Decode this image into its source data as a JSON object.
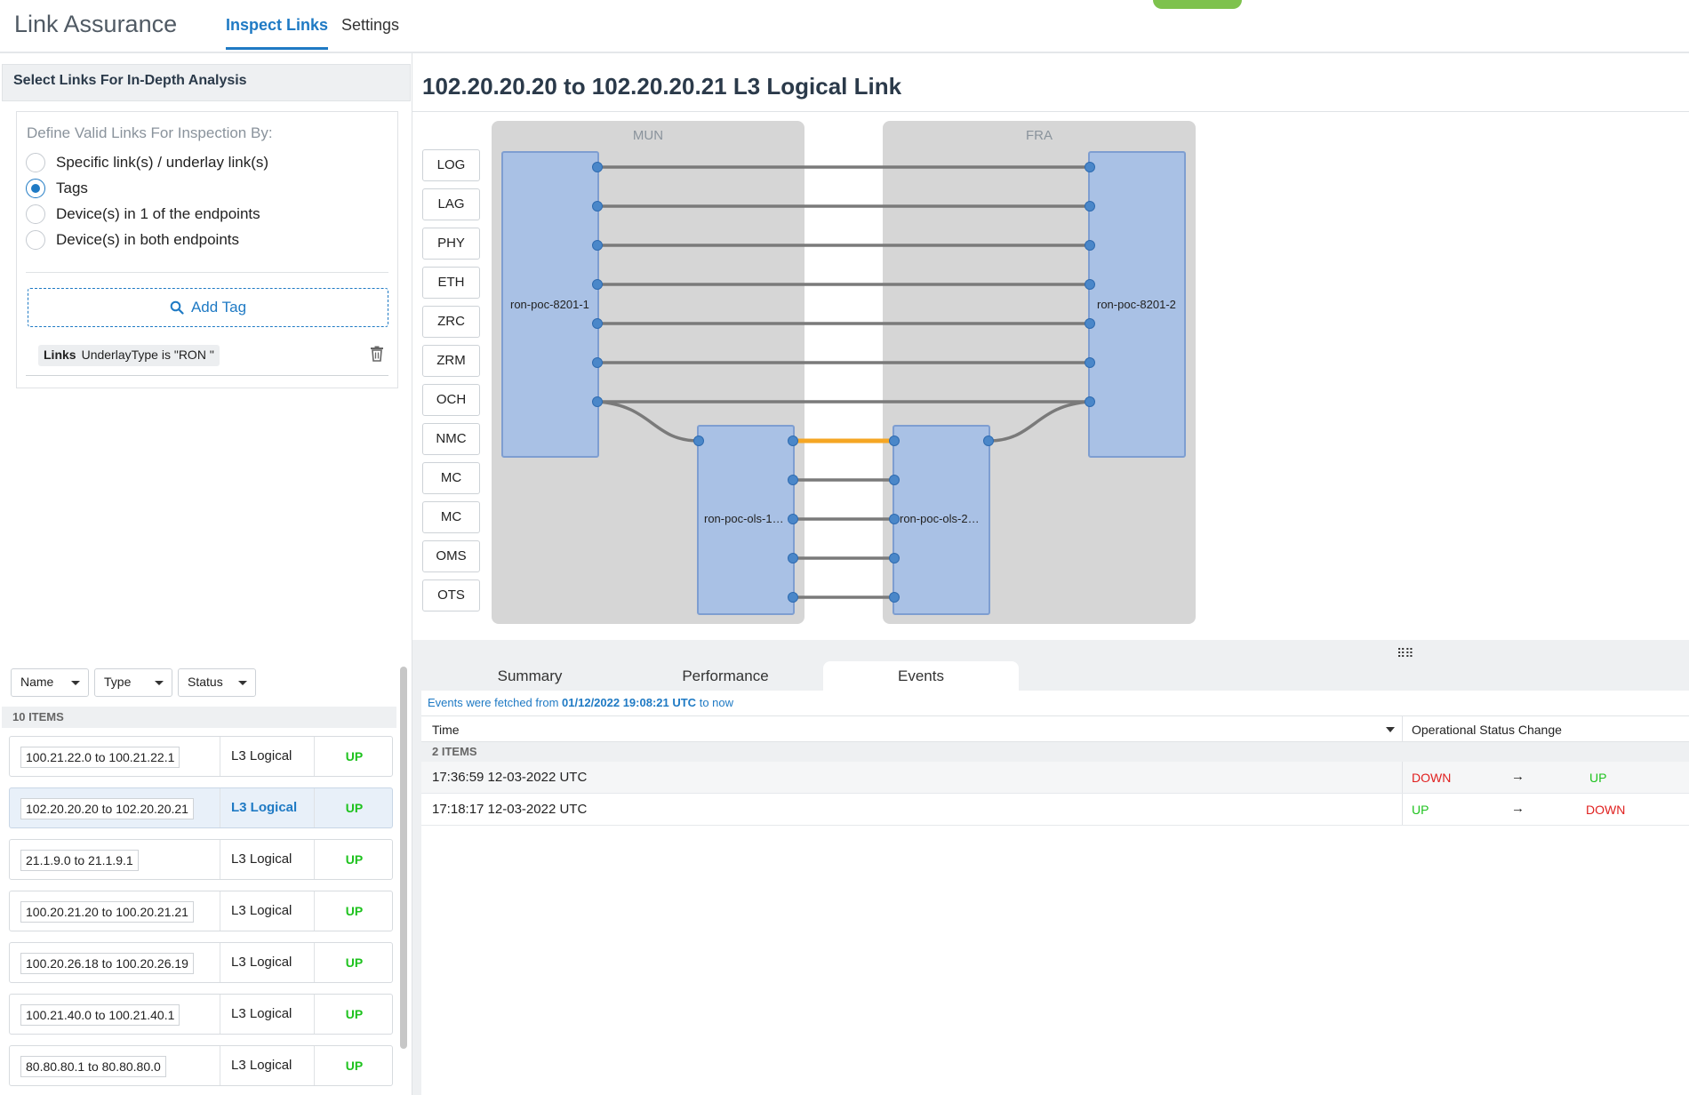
{
  "header": {
    "app_title": "Link Assurance",
    "tabs": [
      {
        "label": "Inspect Links",
        "active": true
      },
      {
        "label": "Settings",
        "active": false
      }
    ]
  },
  "left": {
    "heading": "Select Links For In-Depth Analysis",
    "define_label": "Define Valid Links For Inspection By:",
    "options": [
      {
        "label": "Specific link(s) / underlay link(s)",
        "selected": false
      },
      {
        "label": "Tags",
        "selected": true
      },
      {
        "label": "Device(s) in 1 of the endpoints",
        "selected": false
      },
      {
        "label": "Device(s) in both endpoints",
        "selected": false
      }
    ],
    "add_tag_label": "Add Tag",
    "tag": {
      "key": "Links",
      "value": "UnderlayType is \"RON \""
    },
    "filters": [
      "Name",
      "Type",
      "Status"
    ],
    "items_count": "10 ITEMS",
    "links": [
      {
        "name": "100.21.22.0 to 100.21.22.1",
        "type": "L3 Logical",
        "status": "UP",
        "selected": false
      },
      {
        "name": "102.20.20.20 to 102.20.20.21",
        "type": "L3 Logical",
        "status": "UP",
        "selected": true
      },
      {
        "name": "21.1.9.0 to 21.1.9.1",
        "type": "L3 Logical",
        "status": "UP",
        "selected": false
      },
      {
        "name": "100.20.21.20 to 100.20.21.21",
        "type": "L3 Logical",
        "status": "UP",
        "selected": false
      },
      {
        "name": "100.20.26.18 to 100.20.26.19",
        "type": "L3 Logical",
        "status": "UP",
        "selected": false
      },
      {
        "name": "100.21.40.0 to 100.21.40.1",
        "type": "L3 Logical",
        "status": "UP",
        "selected": false
      },
      {
        "name": "80.80.80.1 to 80.80.80.0",
        "type": "L3 Logical",
        "status": "UP",
        "selected": false
      }
    ]
  },
  "main": {
    "title": "102.20.20.20 to 102.20.20.21 L3 Logical Link",
    "layers": [
      "LOG",
      "LAG",
      "PHY",
      "ETH",
      "ZRC",
      "ZRM",
      "OCH",
      "NMC",
      "MC",
      "MC",
      "OMS",
      "OTS"
    ],
    "sites": [
      {
        "label": "MUN"
      },
      {
        "label": "FRA"
      }
    ],
    "devices": [
      "ron-poc-8201-1",
      "ron-poc-8201-2",
      "ron-poc-ols-1…",
      "ron-poc-ols-2…"
    ],
    "colors": {
      "device_fill": "#a9c1e5",
      "link": "#7a7a7a",
      "highlight_link": "#f5a623",
      "port": "#4a87c9"
    }
  },
  "bottom": {
    "tabs": [
      {
        "label": "Summary",
        "active": false
      },
      {
        "label": "Performance",
        "active": false
      },
      {
        "label": "Events",
        "active": true
      }
    ],
    "fetch_prefix": "Events were fetched from",
    "fetch_time": "01/12/2022 19:08:21 UTC",
    "fetch_suffix": "to now",
    "col_time": "Time",
    "col_status": "Operational Status Change",
    "items_count": "2 ITEMS",
    "events": [
      {
        "time": "17:36:59 12-03-2022 UTC",
        "from": "DOWN",
        "arrow": "→",
        "to": "UP"
      },
      {
        "time": "17:18:17 12-03-2022 UTC",
        "from": "UP",
        "arrow": "→",
        "to": "DOWN"
      }
    ]
  }
}
